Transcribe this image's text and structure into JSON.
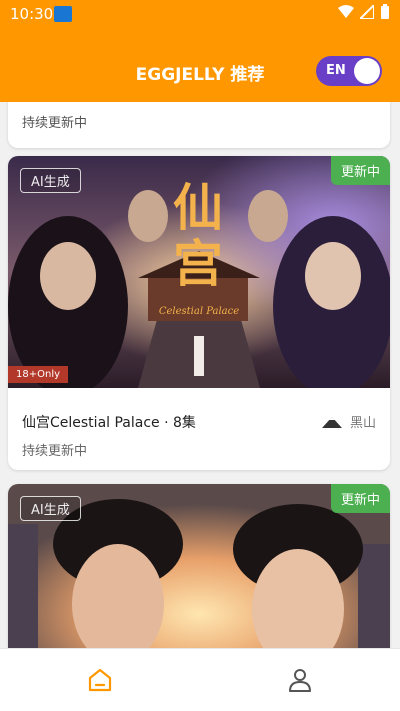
{
  "status_bar": {
    "time": "10:30"
  },
  "header": {
    "title": "EGGJELLY 推荐",
    "lang_toggle": "EN"
  },
  "cards": [
    {
      "status": "持续更新中"
    },
    {
      "ai_badge": "AI生成",
      "update_badge": "更新中",
      "age_badge": "18+Only",
      "cover_title": "仙宫",
      "cover_subtitle": "Celestial Palace",
      "title": "仙宫Celestial Palace · 8集",
      "studio": "黑山",
      "status": "持续更新中"
    },
    {
      "ai_badge": "AI生成",
      "update_badge": "更新中"
    }
  ],
  "colors": {
    "header": "#ff9800",
    "toggle": "#6a3fc7",
    "update_badge": "#4caf50",
    "age_badge": "#b2382a"
  },
  "tabs": [
    {
      "icon": "home-icon",
      "active": true
    },
    {
      "icon": "profile-icon",
      "active": false
    }
  ]
}
